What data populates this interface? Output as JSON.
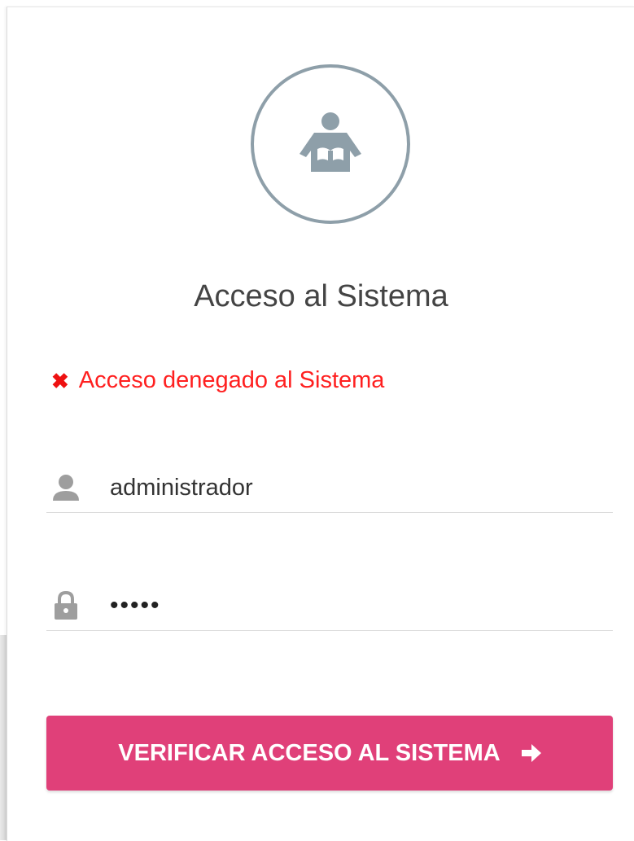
{
  "login": {
    "title": "Acceso al Sistema",
    "error_message": "Acceso denegado al Sistema",
    "error_icon": "close-icon",
    "username": {
      "icon": "user-icon",
      "value": "administrador"
    },
    "password": {
      "icon": "lock-icon",
      "value": "•••••"
    },
    "submit_label": "VERIFICAR ACCESO AL SISTEMA",
    "submit_icon": "arrow-right-icon"
  },
  "colors": {
    "accent": "#e04079",
    "error": "#ff2020",
    "avatar": "#8e9fa9",
    "field_icon": "#9e9e9e"
  }
}
